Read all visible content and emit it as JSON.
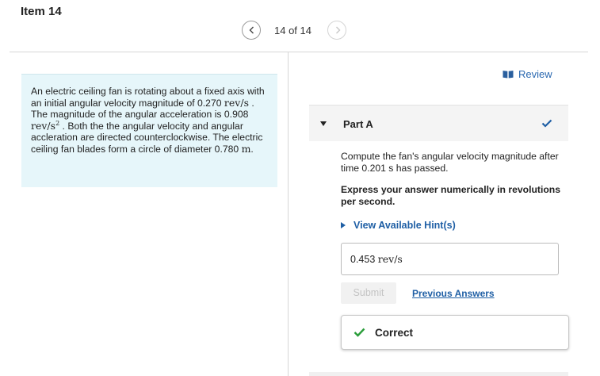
{
  "item": {
    "title": "Item 14"
  },
  "pager": {
    "count": "14 of 14"
  },
  "problem": {
    "p1": "An electric ceiling fan is rotating about a fixed axis with an initial angular velocity magnitude of 0.270",
    "unit_velocity": "rev/s",
    "p2": ". The magnitude of the angular acceleration is 0.908",
    "unit_accel": "rev/s",
    "unit_accel_exp": "2",
    "p3": ". Both the the angular velocity and angular accleration are directed counterclockwise. The electric ceiling fan blades form a circle of diameter 0.780",
    "unit_length": "m",
    "p4": "."
  },
  "review": {
    "label": "Review"
  },
  "part": {
    "title": "Part A",
    "prompt": "Compute the fan's angular velocity magnitude after time 0.201 s has passed.",
    "instruction": "Express your answer numerically in revolutions per second.",
    "hint_label": "View Available Hint(s)",
    "answer_value": "0.453",
    "answer_unit": "rev/s",
    "submit_label": "Submit",
    "previous_answers_label": "Previous Answers",
    "correct_label": "Correct"
  },
  "colors": {
    "problem_bg": "#e6f6fa",
    "link": "#1f5fa5",
    "correct_green": "#2a9d3a",
    "check_blue": "#1f5fa5"
  },
  "icons": {
    "prev": "chevron-left-icon",
    "next": "chevron-right-icon",
    "review": "book-icon",
    "collapse": "caret-down-icon",
    "part_status": "checkmark-icon",
    "hint": "caret-right-icon",
    "correct": "checkmark-icon"
  }
}
